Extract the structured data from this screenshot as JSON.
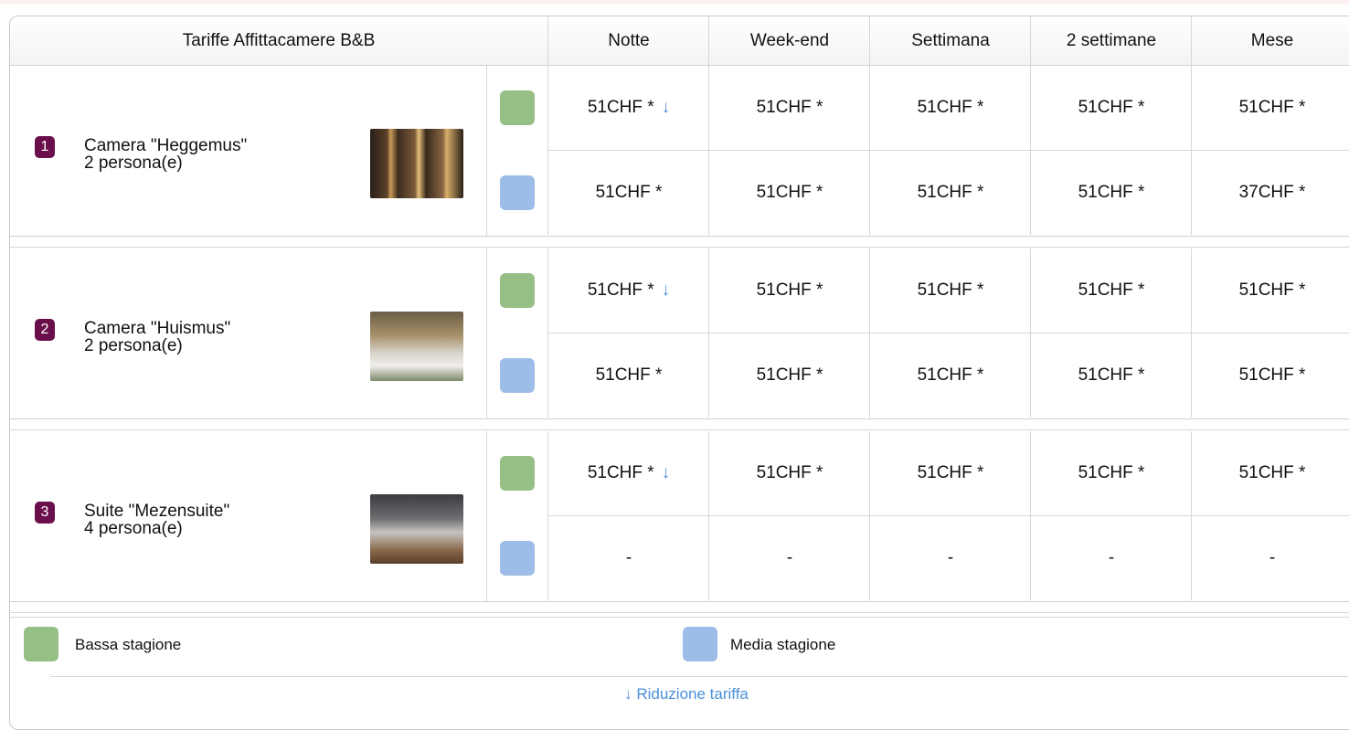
{
  "table": {
    "title": "Tariffe Affittacamere B&B",
    "columns": [
      "Notte",
      "Week-end",
      "Settimana",
      "2 settimane",
      "Mese"
    ],
    "seasons": [
      {
        "name": "Bassa stagione",
        "color": "#96bf86"
      },
      {
        "name": "Media stagione",
        "color": "#9bbde8"
      }
    ],
    "reduction_marker": "↓",
    "rooms": [
      {
        "number": "1",
        "name": "Camera \"Heggemus\"",
        "capacity": "2 persona(e)",
        "rows": [
          [
            "51CHF *",
            "51CHF *",
            "51CHF *",
            "51CHF *",
            "51CHF *"
          ],
          [
            "51CHF *",
            "51CHF *",
            "51CHF *",
            "51CHF *",
            "37CHF *"
          ]
        ]
      },
      {
        "number": "2",
        "name": "Camera \"Huismus\"",
        "capacity": "2 persona(e)",
        "rows": [
          [
            "51CHF *",
            "51CHF *",
            "51CHF *",
            "51CHF *",
            "51CHF *"
          ],
          [
            "51CHF *",
            "51CHF *",
            "51CHF *",
            "51CHF *",
            "51CHF *"
          ]
        ]
      },
      {
        "number": "3",
        "name": "Suite \"Mezensuite\"",
        "capacity": "4 persona(e)",
        "rows": [
          [
            "51CHF *",
            "51CHF *",
            "51CHF *",
            "51CHF *",
            "51CHF *"
          ],
          [
            "-",
            "-",
            "-",
            "-",
            "-"
          ]
        ]
      }
    ]
  },
  "legend": {
    "low_season": "Bassa stagione",
    "mid_season": "Media stagione",
    "reduction": "↓ Riduzione tariffa"
  }
}
